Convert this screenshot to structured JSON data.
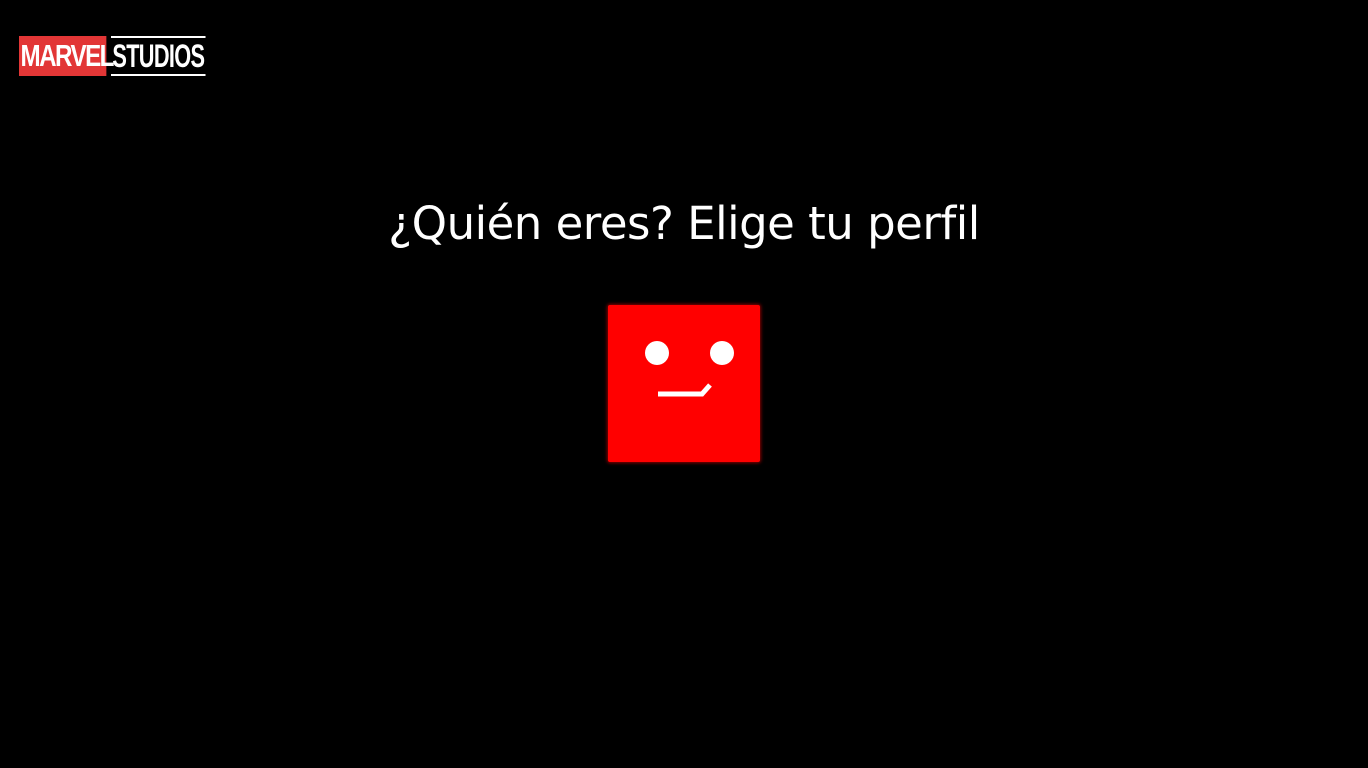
{
  "logo": {
    "marvel": "MARVEL",
    "studios": "STUDIOS",
    "brand_color": "#e23636"
  },
  "heading": "¿Quién eres? Elige tu perfil",
  "profiles": [
    {
      "icon": "smiley-face-icon",
      "color": "#ff0000"
    }
  ]
}
